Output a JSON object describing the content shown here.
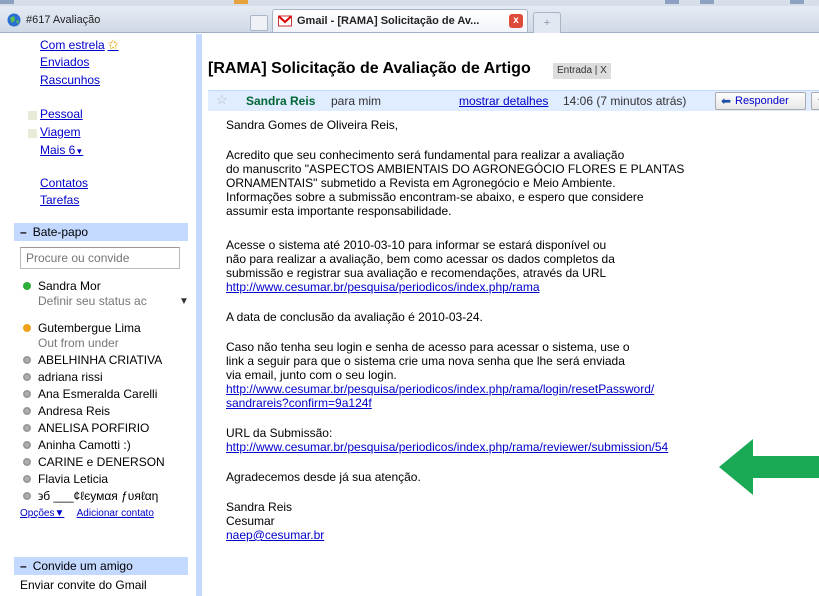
{
  "browser": {
    "tabs": [
      {
        "label": "#617 Avaliação"
      },
      {
        "label": "Gmail - [RAMA] Solicitação de Av...",
        "close": "x"
      }
    ],
    "new_tab": "+"
  },
  "sidebar": {
    "nav": [
      {
        "label": "Com estrela"
      },
      {
        "label": "Enviados"
      },
      {
        "label": "Rascunhos"
      },
      {
        "label": "Pessoal"
      },
      {
        "label": "Viagem"
      },
      {
        "label": "Mais 6"
      },
      {
        "label": "Contatos"
      },
      {
        "label": "Tarefas"
      }
    ],
    "chat": {
      "collapse": "–",
      "title": "Bate-papo",
      "search_placeholder": "Procure ou convide",
      "me": {
        "name": "Sandra Mor",
        "status": "Definir seu status ac"
      },
      "contacts": [
        {
          "name": "Gutembergue Lima",
          "status": "Out from under",
          "presence": "away"
        },
        {
          "name": "ABELHINHA CRIATIVA",
          "presence": "offline"
        },
        {
          "name": "adriana rissi",
          "presence": "offline"
        },
        {
          "name": "Ana Esmeralda Carelli",
          "presence": "offline"
        },
        {
          "name": "Andresa Reis",
          "presence": "offline"
        },
        {
          "name": "ANELISA PORFIRIO",
          "presence": "offline"
        },
        {
          "name": "Aninha Camotti :)",
          "presence": "offline"
        },
        {
          "name": "CARINE e DENERSON",
          "presence": "offline"
        },
        {
          "name": "Flavia Leticia",
          "presence": "offline"
        },
        {
          "name": "϶б ___¢ℓєумαя ƒυяℓαη",
          "presence": "offline"
        }
      ],
      "options": "Opções",
      "add_contact": "Adicionar contato"
    },
    "invite": {
      "collapse": "–",
      "title": "Convide um amigo",
      "text": "Enviar convite do Gmail"
    }
  },
  "message": {
    "subject": "[RAMA] Solicitação de Avaliação de Artigo",
    "label_badge": "Entrada | X",
    "sender": "Sandra Reis",
    "recipient": "para mim",
    "show_details": "mostrar detalhes",
    "time": "14:06 (7 minutos atrás)",
    "reply": "Responder",
    "greeting": "Sandra Gomes de Oliveira Reis,",
    "para1": "Acredito que seu conhecimento será fundamental para realizar a avaliação\ndo manuscrito \"ASPECTOS AMBIENTAIS DO AGRONEGÓCIO FLORES E PLANTAS\nORNAMENTAIS\" submetido a Revista em Agronegócio e Meio Ambiente.\nInformações sobre a submissão encontram-se abaixo, e espero que considere\nassumir esta importante responsabilidade.",
    "para2": "Acesse o sistema até 2010-03-10 para informar se estará disponível ou\nnão para realizar a avaliação, bem como acessar os dados completos da\nsubmissão e registrar sua avaliação e recomendações, através da URL",
    "para2_link": "http://www.cesumar.br/pesquisa/periodicos/index.php/rama",
    "para3": "A data de conclusão da avaliação é 2010-03-24.",
    "para4": "Caso não tenha seu login e senha de acesso para acessar o sistema, use o\nlink a seguir para que o sistema crie uma nova senha que lhe será enviada\nvia email, junto com o seu login.",
    "para4_link1": "http://www.cesumar.br/pesquisa/periodicos/index.php/rama/login/resetPassword/",
    "para4_link2": "sandrareis?confirm=9a124f",
    "url_label": "URL da Submissão:",
    "url_link": "http://www.cesumar.br/pesquisa/periodicos/index.php/rama/reviewer/submission/54",
    "thanks": "Agradecemos desde já sua atenção.",
    "sig_name": "Sandra Reis",
    "sig_org": "Cesumar",
    "sig_email": "naep@cesumar.br"
  },
  "colors": {
    "accent": "#c3d9ff",
    "arrow": "#1aaa55"
  }
}
